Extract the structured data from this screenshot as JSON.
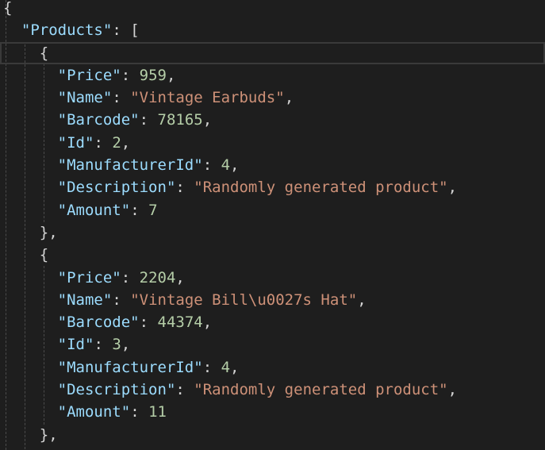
{
  "editor": {
    "root_key": "Products",
    "products": [
      {
        "fields": [
          {
            "key": "Price",
            "value": "959",
            "type": "num"
          },
          {
            "key": "Name",
            "value": "Vintage Earbuds",
            "type": "str"
          },
          {
            "key": "Barcode",
            "value": "78165",
            "type": "num"
          },
          {
            "key": "Id",
            "value": "2",
            "type": "num"
          },
          {
            "key": "ManufacturerId",
            "value": "4",
            "type": "num"
          },
          {
            "key": "Description",
            "value": "Randomly generated product",
            "type": "str"
          },
          {
            "key": "Amount",
            "value": "7",
            "type": "num"
          }
        ]
      },
      {
        "fields": [
          {
            "key": "Price",
            "value": "2204",
            "type": "num"
          },
          {
            "key": "Name",
            "value": "Vintage Bill\\u0027s Hat",
            "type": "str"
          },
          {
            "key": "Barcode",
            "value": "44374",
            "type": "num"
          },
          {
            "key": "Id",
            "value": "3",
            "type": "num"
          },
          {
            "key": "ManufacturerId",
            "value": "4",
            "type": "num"
          },
          {
            "key": "Description",
            "value": "Randomly generated product",
            "type": "str"
          },
          {
            "key": "Amount",
            "value": "11",
            "type": "num"
          }
        ]
      }
    ]
  },
  "colors": {
    "background": "#1e1e1e",
    "key": "#9cdcfe",
    "string": "#ce9178",
    "number": "#b5cea8",
    "punctuation": "#d4d4d4"
  }
}
